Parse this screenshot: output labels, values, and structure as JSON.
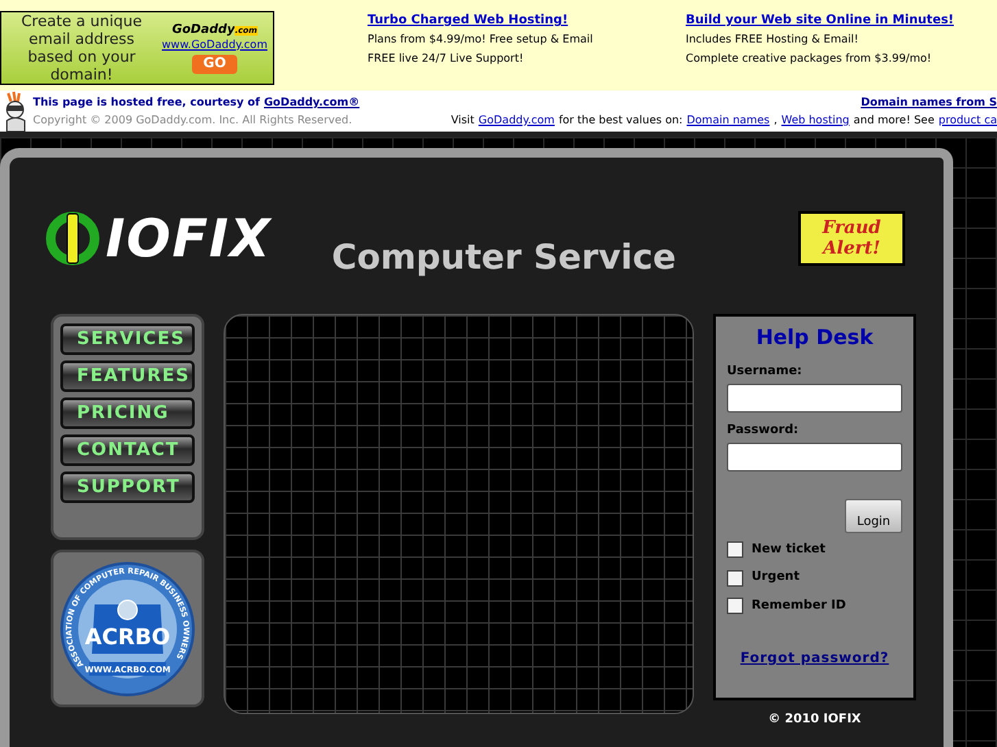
{
  "ad_banner": {
    "text": "Create a unique email address based on your domain!",
    "logo": "GoDaddy",
    "logo_suffix": ".com",
    "url": "www.GoDaddy.com",
    "button": "GO"
  },
  "ads": [
    {
      "title": "Turbo Charged Web Hosting!",
      "lines": [
        "Plans from $4.99/mo! Free setup & Email",
        "FREE live 24/7 Live Support!"
      ]
    },
    {
      "title": "Build your Web site Online in Minutes!",
      "lines": [
        "Includes FREE Hosting & Email!",
        "Complete creative packages from $3.99/mo!"
      ]
    }
  ],
  "hosting_bar": {
    "notice": "This page is hosted free, courtesy of",
    "notice_link": "GoDaddy.com®",
    "copyright": "Copyright © 2009 GoDaddy.com. Inc. All Rights Reserved.",
    "right_link": "Domain names from S",
    "visit": [
      {
        "kind": "text",
        "text": "Visit"
      },
      {
        "kind": "link",
        "text": "GoDaddy.com"
      },
      {
        "kind": "text",
        "text": "for the best values on:"
      },
      {
        "kind": "link",
        "text": "Domain names"
      },
      {
        "kind": "text",
        "text": ","
      },
      {
        "kind": "link",
        "text": "Web hosting"
      },
      {
        "kind": "text",
        "text": "and more! See"
      },
      {
        "kind": "link",
        "text": "product ca"
      }
    ]
  },
  "site": {
    "logo": "IOFIX",
    "tagline": "Computer Service",
    "fraud_alert": "Fraud Alert!",
    "nav": [
      {
        "label": "SERVICES"
      },
      {
        "label": "FEATURES"
      },
      {
        "label": "PRICING"
      },
      {
        "label": "CONTACT"
      },
      {
        "label": "SUPPORT"
      }
    ],
    "badge": {
      "ring": "ASSOCIATION OF COMPUTER REPAIR BUSINESS OWNERS",
      "name": "ACRBO",
      "url": "WWW.ACRBO.COM"
    },
    "help_desk": {
      "title": "Help Desk",
      "fields": [
        {
          "label": "Username:"
        },
        {
          "label": "Password:"
        }
      ],
      "button": "Login",
      "checkboxes": [
        {
          "label": "New ticket",
          "checked": false
        },
        {
          "label": "Urgent",
          "checked": false
        },
        {
          "label": "Remember ID",
          "checked": false
        }
      ],
      "link": "Forgot password?"
    },
    "footer": "© 2010 IOFIX"
  }
}
